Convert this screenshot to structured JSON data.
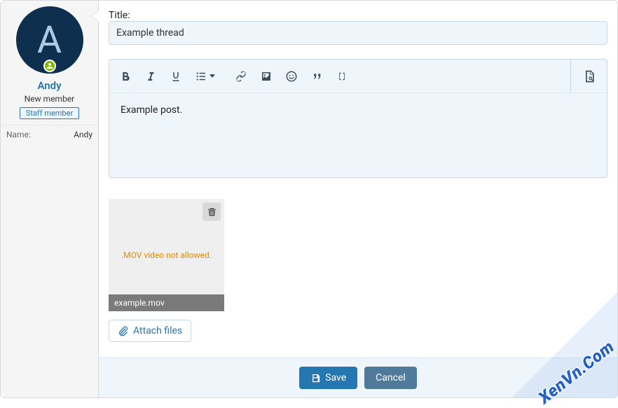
{
  "user": {
    "avatar_letter": "A",
    "name": "Andy",
    "title": "New member",
    "badge": "Staff member",
    "name_label": "Name:",
    "name_value": "Andy"
  },
  "form": {
    "title_label": "Title:",
    "title_value": "Example thread"
  },
  "editor": {
    "content": "Example post."
  },
  "attachment": {
    "error": ".MOV video not allowed.",
    "filename": "example.mov"
  },
  "buttons": {
    "attach": "Attach files",
    "save": "Save",
    "cancel": "Cancel"
  },
  "watermark": "XenVn.Com"
}
